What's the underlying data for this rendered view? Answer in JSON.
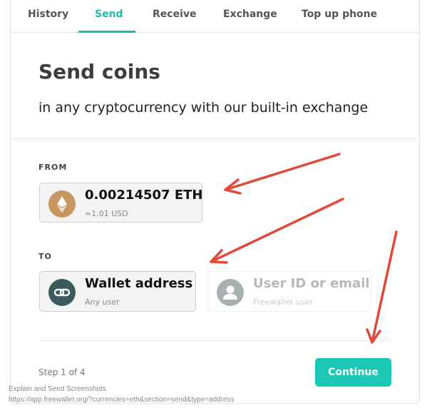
{
  "tabs": [
    {
      "label": "History"
    },
    {
      "label": "Send"
    },
    {
      "label": "Receive"
    },
    {
      "label": "Exchange"
    },
    {
      "label": "Top up phone"
    }
  ],
  "active_tab": "Send",
  "header": {
    "title": "Send coins",
    "subtitle": "in any cryptocurrency with our built-in exchange"
  },
  "from": {
    "label": "FROM",
    "amount": "0.00214507 ETH",
    "fiat": "≈1.01 USD",
    "icon": "ethereum-icon"
  },
  "to": {
    "label": "TO",
    "options": [
      {
        "title": "Wallet address",
        "subtitle": "Any user",
        "icon": "link-icon",
        "selected": true
      },
      {
        "title": "User ID or email",
        "subtitle": "Freewallet user",
        "icon": "user-icon",
        "selected": false
      }
    ]
  },
  "footer": {
    "step": "Step 1 of 4",
    "continue_label": "Continue"
  },
  "caption": {
    "line1": "Explain and Send Screenshots",
    "line2": "https://app.freewallet.org/?currencies=eth&section=send&type=address"
  },
  "colors": {
    "accent": "#1abcb0",
    "button": "#1cc7b5",
    "eth_coin": "#c8965f",
    "link_icon_bg": "#3a5a5c",
    "user_icon_bg": "#a9b0b2",
    "annotation_arrow": "#e04a3a"
  }
}
